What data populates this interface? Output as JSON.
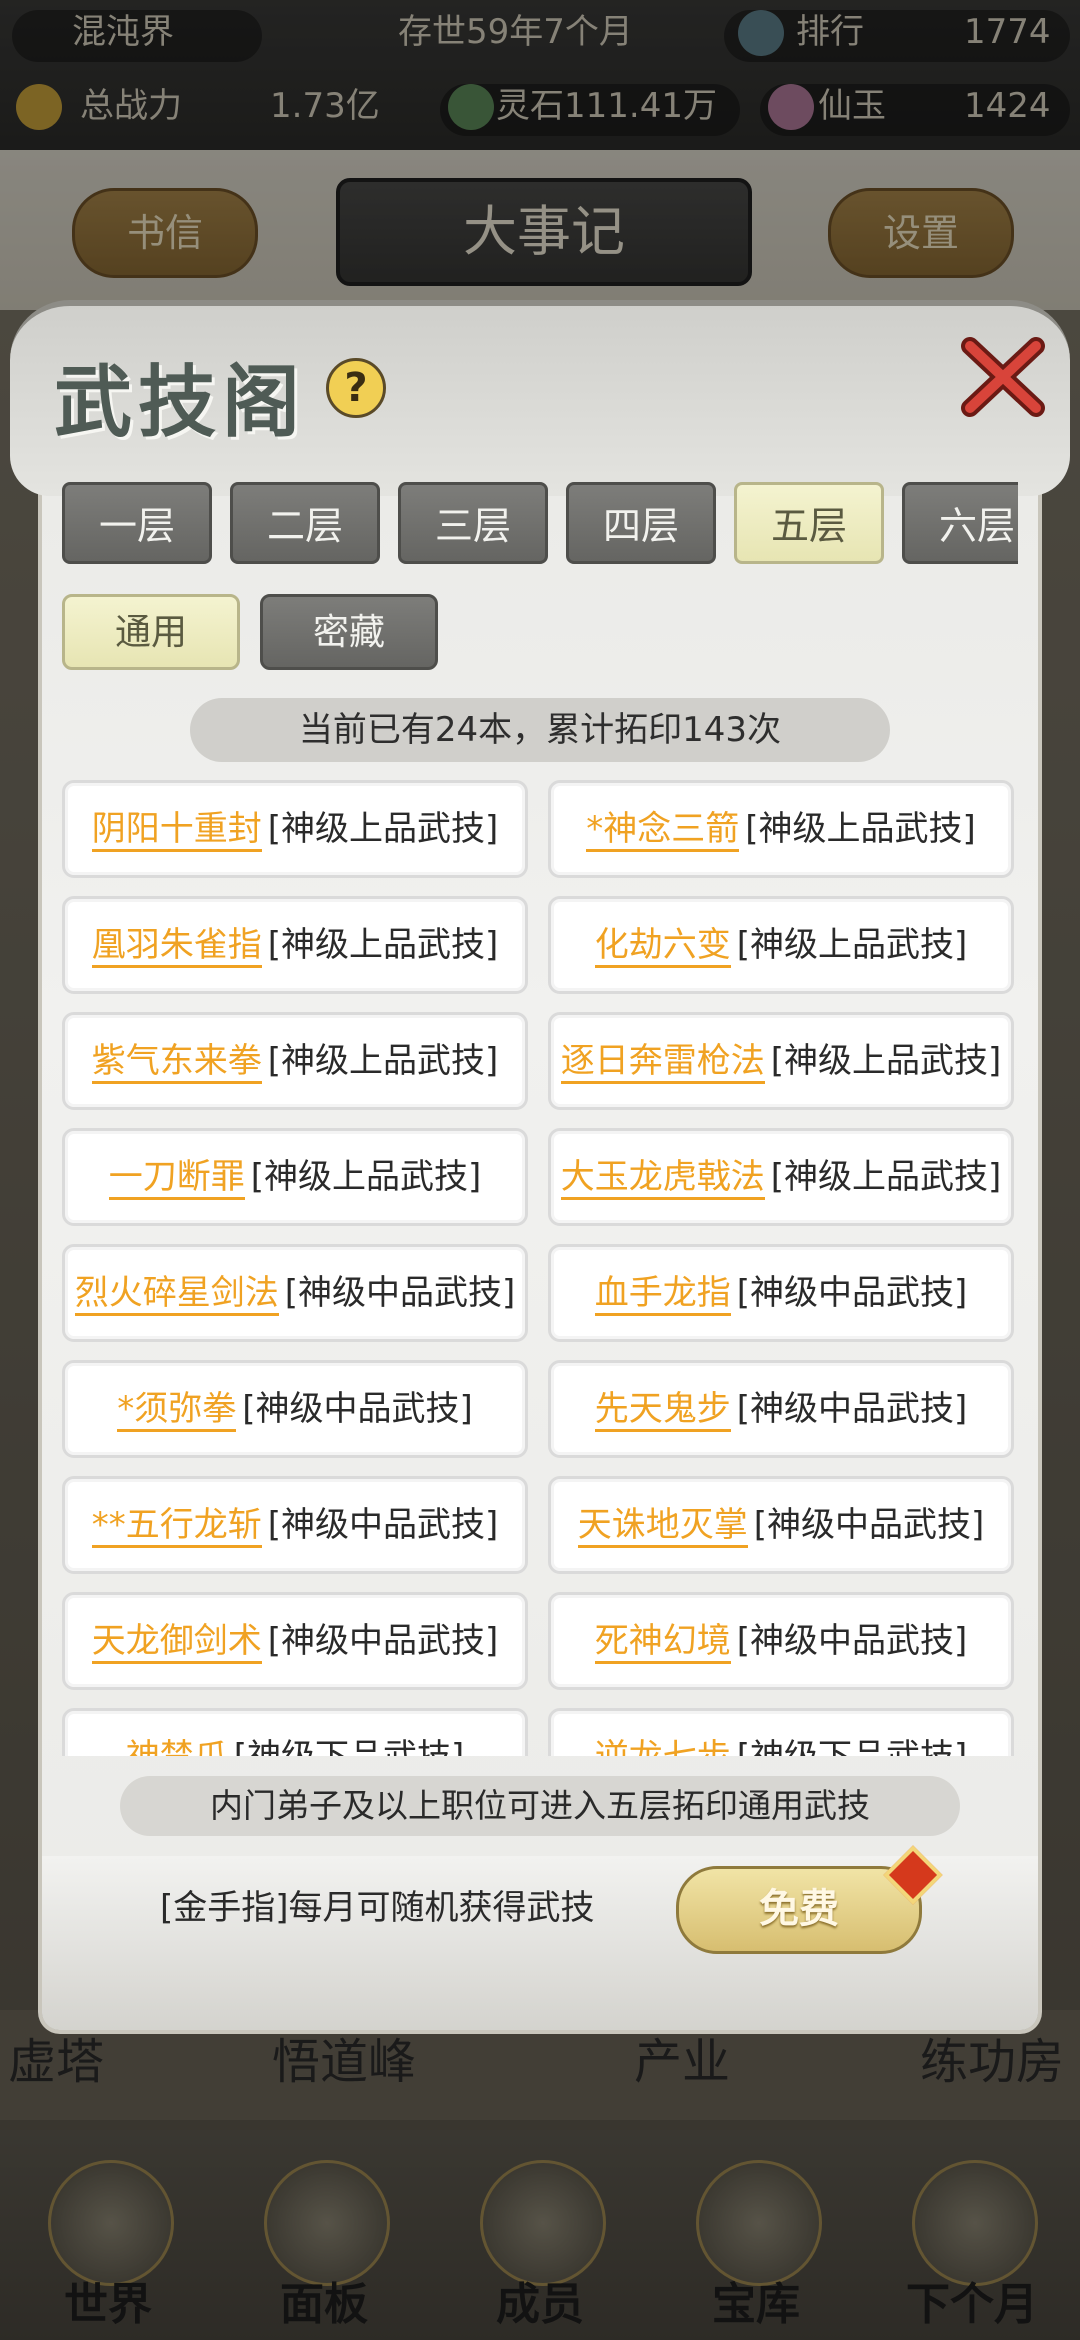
{
  "top_bar": {
    "realm": "混沌界",
    "time": "存世59年7个月",
    "rank_label": "排行",
    "rank_value": "1774",
    "power_label": "总战力",
    "power_value": "1.73亿",
    "spirit_stone": "灵石111.41万",
    "jade_label": "仙玉",
    "jade_value": "1424"
  },
  "header": {
    "left_button": "书信",
    "title": "大事记",
    "right_button": "设置"
  },
  "background_buildings": [
    "虚塔",
    "悟道峰",
    "产业",
    "练功房"
  ],
  "bottom_nav": [
    "世界",
    "面板",
    "成员",
    "宝库",
    "下个月"
  ],
  "dialog": {
    "title": "武技阁",
    "help_icon": "?",
    "floor_tabs": [
      "一层",
      "二层",
      "三层",
      "四层",
      "五层",
      "六层"
    ],
    "active_floor": "五层",
    "sub_tabs": [
      "通用",
      "密藏"
    ],
    "active_sub_tab": "通用",
    "summary": "当前已有24本，累计拓印143次",
    "skills": [
      {
        "name": "阴阳十重封",
        "grade": "[神级上品武技]"
      },
      {
        "name": "*神念三箭",
        "grade": "[神级上品武技]"
      },
      {
        "name": "凰羽朱雀指",
        "grade": "[神级上品武技]"
      },
      {
        "name": "化劫六变",
        "grade": "[神级上品武技]"
      },
      {
        "name": "紫气东来拳",
        "grade": "[神级上品武技]"
      },
      {
        "name": "逐日奔雷枪法",
        "grade": "[神级上品武技]"
      },
      {
        "name": "一刀断罪",
        "grade": "[神级上品武技]"
      },
      {
        "name": "大玉龙虎戟法",
        "grade": "[神级上品武技]"
      },
      {
        "name": "烈火碎星剑法",
        "grade": "[神级中品武技]"
      },
      {
        "name": "血手龙指",
        "grade": "[神级中品武技]"
      },
      {
        "name": "*须弥拳",
        "grade": "[神级中品武技]"
      },
      {
        "name": "先天鬼步",
        "grade": "[神级中品武技]"
      },
      {
        "name": "**五行龙斩",
        "grade": "[神级中品武技]"
      },
      {
        "name": "天诛地灭掌",
        "grade": "[神级中品武技]"
      },
      {
        "name": "天龙御剑术",
        "grade": "[神级中品武技]"
      },
      {
        "name": "死神幻境",
        "grade": "[神级中品武技]"
      },
      {
        "name": "神禁爪",
        "grade": "[神级下品武技]"
      },
      {
        "name": "逆龙七步",
        "grade": "[神级下品武技]"
      }
    ],
    "notice": "内门弟子及以上职位可进入五层拓印通用武技",
    "golden_finger": "[金手指]每月可随机获得武技",
    "free_button": "免费"
  },
  "colors": {
    "skill_name": "#f0a222",
    "active_tab": "#e7e5b3",
    "inactive_tab": "#6f6f6c",
    "free_button": "#d7be70"
  }
}
